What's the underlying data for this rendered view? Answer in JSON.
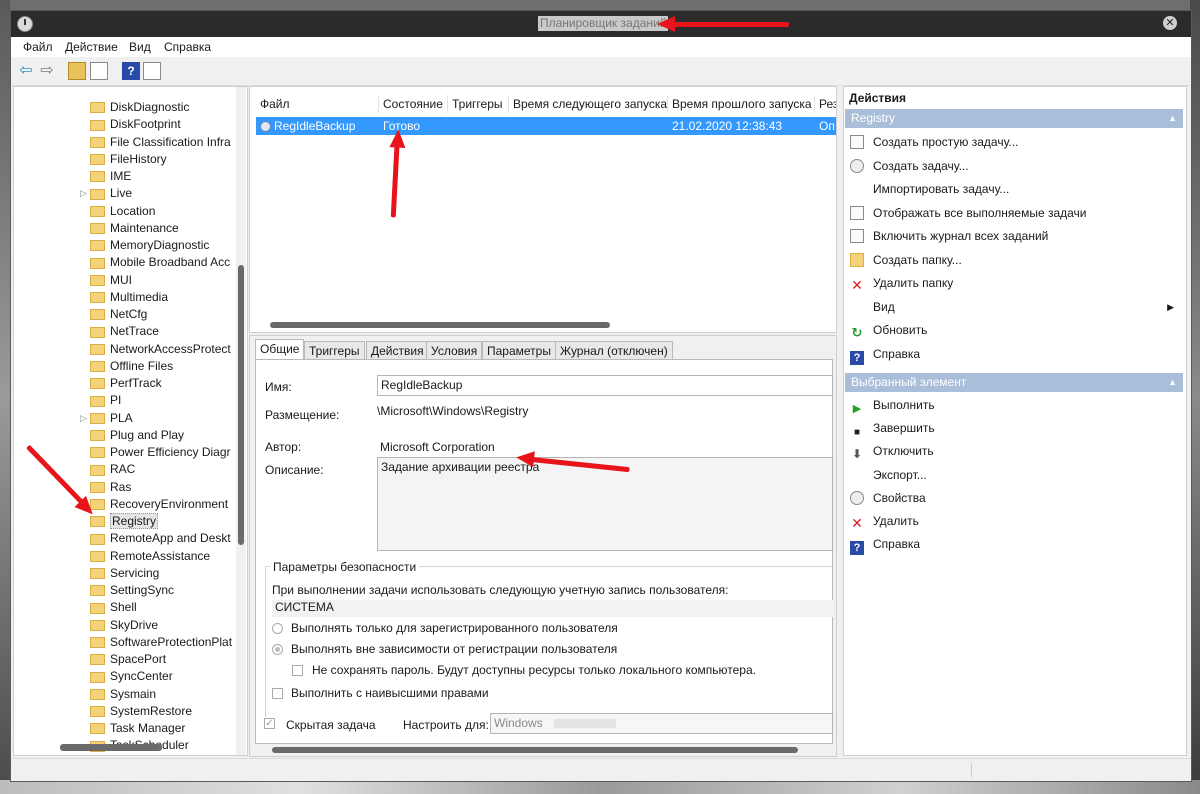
{
  "window": {
    "title": "Планировщик заданий",
    "close_glyph": "✕"
  },
  "menu": [
    "Файл",
    "Действие",
    "Вид",
    "Справка"
  ],
  "toolbar": {
    "back_glyph": "⇦",
    "forward_glyph": "⇨",
    "help_glyph": "?"
  },
  "tree": {
    "items": [
      "DiskDiagnostic",
      "DiskFootprint",
      "File Classification Infra",
      "FileHistory",
      "IME",
      "Live",
      "Location",
      "Maintenance",
      "MemoryDiagnostic",
      "Mobile Broadband Acc",
      "MUI",
      "Multimedia",
      "NetCfg",
      "NetTrace",
      "NetworkAccessProtect",
      "Offline Files",
      "PerfTrack",
      "PI",
      "PLA",
      "Plug and Play",
      "Power Efficiency Diagr",
      "RAC",
      "Ras",
      "RecoveryEnvironment",
      "Registry",
      "RemoteApp and Deskt",
      "RemoteAssistance",
      "Servicing",
      "SettingSync",
      "Shell",
      "SkyDrive",
      "SoftwareProtectionPlat",
      "SpacePort",
      "SyncCenter",
      "Sysmain",
      "SystemRestore",
      "Task Manager",
      "TaskScheduler"
    ],
    "expandable": [
      "Live",
      "PLA"
    ],
    "selected": "Registry",
    "expand_glyph": "▷"
  },
  "tasks": {
    "columns": [
      "Файл",
      "Состояние",
      "Триггеры",
      "Время следующего запуска",
      "Время прошлого запуска",
      "Рез"
    ],
    "row": {
      "name": "RegIdleBackup",
      "status": "Готово",
      "triggers": "",
      "next_run": "",
      "last_run": "21.02.2020 12:38:43",
      "result": "Оп"
    }
  },
  "detail": {
    "tabs": [
      "Общие",
      "Триггеры",
      "Действия",
      "Условия",
      "Параметры",
      "Журнал (отключен)"
    ],
    "active_tab": "Общие",
    "name_label": "Имя:",
    "name_value": "RegIdleBackup",
    "location_label": "Размещение:",
    "location_value": "\\Microsoft\\Windows\\Registry",
    "author_label": "Автор:",
    "author_value": "Microsoft Corporation",
    "description_label": "Описание:",
    "description_value": "Задание архивации реестра",
    "security_group": "Параметры безопасности",
    "account_prompt": "При выполнении задачи использовать следующую учетную запись пользователя:",
    "account_value": "СИСТЕМА",
    "radio_logged_on": "Выполнять только для зарегистрированного пользователя",
    "radio_always": "Выполнять вне зависимости от регистрации пользователя",
    "no_store_password": "Не сохранять пароль. Будут доступны ресурсы только локального компьютера.",
    "highest_privileges": "Выполнить с наивысшими правами",
    "hidden_task": "Скрытая задача",
    "configure_for_label": "Настроить для:",
    "configure_for_value": "Windows"
  },
  "actions": {
    "header": "Действия",
    "section1": "Registry",
    "items1": [
      {
        "label": "Создать простую задачу...",
        "icon": "page-clock-icon"
      },
      {
        "label": "Создать задачу...",
        "icon": "clock-icon"
      },
      {
        "label": "Импортировать задачу...",
        "icon": "none"
      },
      {
        "label": "Отображать все выполняемые задачи",
        "icon": "list-icon"
      },
      {
        "label": "Включить журнал всех заданий",
        "icon": "log-icon"
      },
      {
        "label": "Создать папку...",
        "icon": "folder-icon"
      },
      {
        "label": "Удалить папку",
        "icon": "delete-icon"
      },
      {
        "label": "Вид",
        "icon": "none",
        "submenu": true
      },
      {
        "label": "Обновить",
        "icon": "refresh-icon"
      },
      {
        "label": "Справка",
        "icon": "help-icon"
      }
    ],
    "section2": "Выбранный элемент",
    "items2": [
      {
        "label": "Выполнить",
        "icon": "play-icon"
      },
      {
        "label": "Завершить",
        "icon": "stop-icon"
      },
      {
        "label": "Отключить",
        "icon": "disable-icon"
      },
      {
        "label": "Экспорт...",
        "icon": "none"
      },
      {
        "label": "Свойства",
        "icon": "properties-icon"
      },
      {
        "label": "Удалить",
        "icon": "delete-icon"
      },
      {
        "label": "Справка",
        "icon": "help-icon"
      }
    ],
    "collapse_glyph": "▲",
    "submenu_glyph": "▶"
  },
  "colors": {
    "selection": "#3399ff",
    "section_header": "#a9bfd9",
    "annotation_arrow": "#e8141c"
  }
}
